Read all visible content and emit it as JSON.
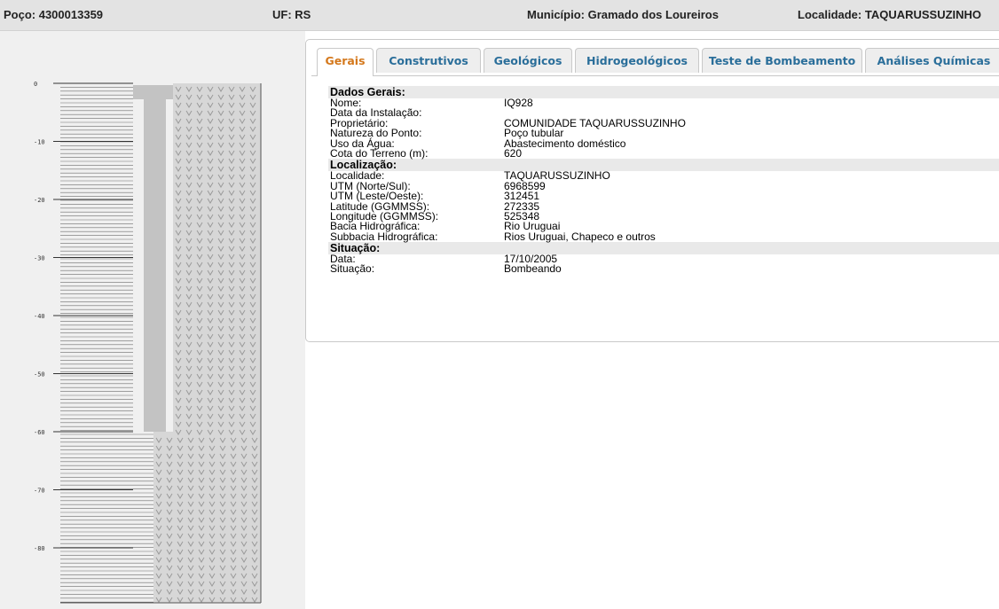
{
  "header": {
    "poco": "Poço: 4300013359",
    "uf": "UF: RS",
    "municipio": "Município: Gramado dos Loureiros",
    "localidade": "Localidade: TAQUARUSSUZINHO"
  },
  "tabs": [
    {
      "label": "Gerais",
      "active": true
    },
    {
      "label": "Construtivos"
    },
    {
      "label": "Geológicos"
    },
    {
      "label": "Hidrogeológicos"
    },
    {
      "label": "Teste de Bombeamento"
    },
    {
      "label": "Análises Químicas"
    }
  ],
  "sections": {
    "dados_gerais": {
      "title": "Dados Gerais:",
      "rows": [
        {
          "label": "Nome:",
          "value": "IQ928"
        },
        {
          "label": "Data da Instalação:",
          "value": ""
        },
        {
          "label": "Proprietário:",
          "value": "COMUNIDADE TAQUARUSSUZINHO"
        },
        {
          "label": "Natureza do Ponto:",
          "value": "Poço tubular"
        },
        {
          "label": "Uso da Água:",
          "value": "Abastecimento doméstico"
        },
        {
          "label": "Cota do Terreno (m):",
          "value": "620"
        }
      ]
    },
    "localizacao": {
      "title": "Localização:",
      "rows": [
        {
          "label": "Localidade:",
          "value": "TAQUARUSSUZINHO"
        },
        {
          "label": "UTM (Norte/Sul):",
          "value": "6968599"
        },
        {
          "label": "UTM (Leste/Oeste):",
          "value": "312451"
        },
        {
          "label": "Latitude (GGMMSS):",
          "value": "272335"
        },
        {
          "label": "Longitude (GGMMSS):",
          "value": "525348"
        },
        {
          "label": "Bacia Hidrográfica:",
          "value": "Rio Uruguai"
        },
        {
          "label": "Subbacia Hidrográfica:",
          "value": "Rios Uruguai, Chapeco e outros"
        }
      ]
    },
    "situacao": {
      "title": "Situação:",
      "rows": [
        {
          "label": "Data:",
          "value": "17/10/2005"
        },
        {
          "label": "Situação:",
          "value": "Bombeando"
        }
      ]
    }
  },
  "profile": {
    "depth_labels": [
      "0",
      "-10",
      "-20",
      "-30",
      "-40",
      "-50",
      "-60",
      "-70",
      "-80"
    ],
    "depth_values": [
      0,
      -10,
      -20,
      -30,
      -40,
      -50,
      -60,
      -70,
      -80
    ],
    "casing_bottom_depth": -60,
    "colors": {
      "casing": "#c3c3c3",
      "rock": "#d7d7d7",
      "lines": "#6e6e6e"
    }
  }
}
